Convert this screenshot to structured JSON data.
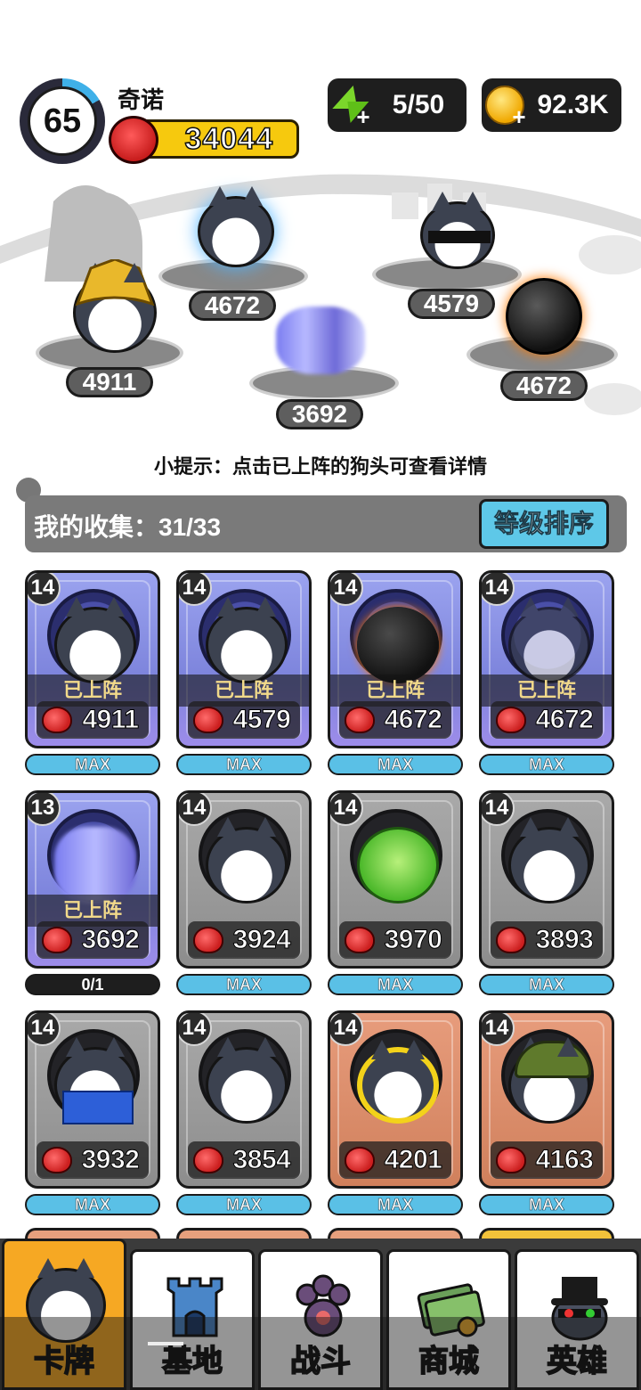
{
  "player": {
    "level": "65",
    "name": "奇诺",
    "power": "34044"
  },
  "resources": {
    "energy": "5/50",
    "coins": "92.3K"
  },
  "formation": [
    {
      "power": "4911",
      "desc": "golden-helmet-dog"
    },
    {
      "power": "4672",
      "desc": "cyber-eye-dog"
    },
    {
      "power": "3692",
      "desc": "blurred-dog"
    },
    {
      "power": "4579",
      "desc": "sunglasses-crown-dog"
    },
    {
      "power": "4672",
      "desc": "bomb-dog"
    }
  ],
  "hint": "小提示：点击已上阵的狗头可查看详情",
  "collection": {
    "label": "我的收集：31/33",
    "sort_button": "等级排序"
  },
  "cards": [
    {
      "level": "14",
      "power": "4911",
      "deployed": "已上阵",
      "progress": "MAX",
      "rarity": "purple"
    },
    {
      "level": "14",
      "power": "4579",
      "deployed": "已上阵",
      "progress": "MAX",
      "rarity": "purple"
    },
    {
      "level": "14",
      "power": "4672",
      "deployed": "已上阵",
      "progress": "MAX",
      "rarity": "purple"
    },
    {
      "level": "14",
      "power": "4672",
      "deployed": "已上阵",
      "progress": "MAX",
      "rarity": "purple"
    },
    {
      "level": "13",
      "power": "3692",
      "deployed": "已上阵",
      "progress": "0/1",
      "rarity": "purple"
    },
    {
      "level": "14",
      "power": "3924",
      "deployed": "",
      "progress": "MAX",
      "rarity": "gray"
    },
    {
      "level": "14",
      "power": "3970",
      "deployed": "",
      "progress": "MAX",
      "rarity": "gray"
    },
    {
      "level": "14",
      "power": "3893",
      "deployed": "",
      "progress": "MAX",
      "rarity": "gray"
    },
    {
      "level": "14",
      "power": "3932",
      "deployed": "",
      "progress": "MAX",
      "rarity": "gray"
    },
    {
      "level": "14",
      "power": "3854",
      "deployed": "",
      "progress": "MAX",
      "rarity": "gray"
    },
    {
      "level": "14",
      "power": "4201",
      "deployed": "",
      "progress": "MAX",
      "rarity": "bronze"
    },
    {
      "level": "14",
      "power": "4163",
      "deployed": "",
      "progress": "MAX",
      "rarity": "bronze"
    }
  ],
  "nav": [
    {
      "label": "卡牌",
      "icon": "dog-card-icon",
      "active": true
    },
    {
      "label": "基地",
      "icon": "castle-icon",
      "active": false
    },
    {
      "label": "战斗",
      "icon": "paw-icon",
      "active": false
    },
    {
      "label": "商城",
      "icon": "cash-icon",
      "active": false
    },
    {
      "label": "英雄",
      "icon": "hero-hat-icon",
      "active": false
    }
  ],
  "colors": {
    "accent": "#f6a823",
    "sort_button": "#5ec8e8",
    "power_pill": "#f6c90e"
  }
}
